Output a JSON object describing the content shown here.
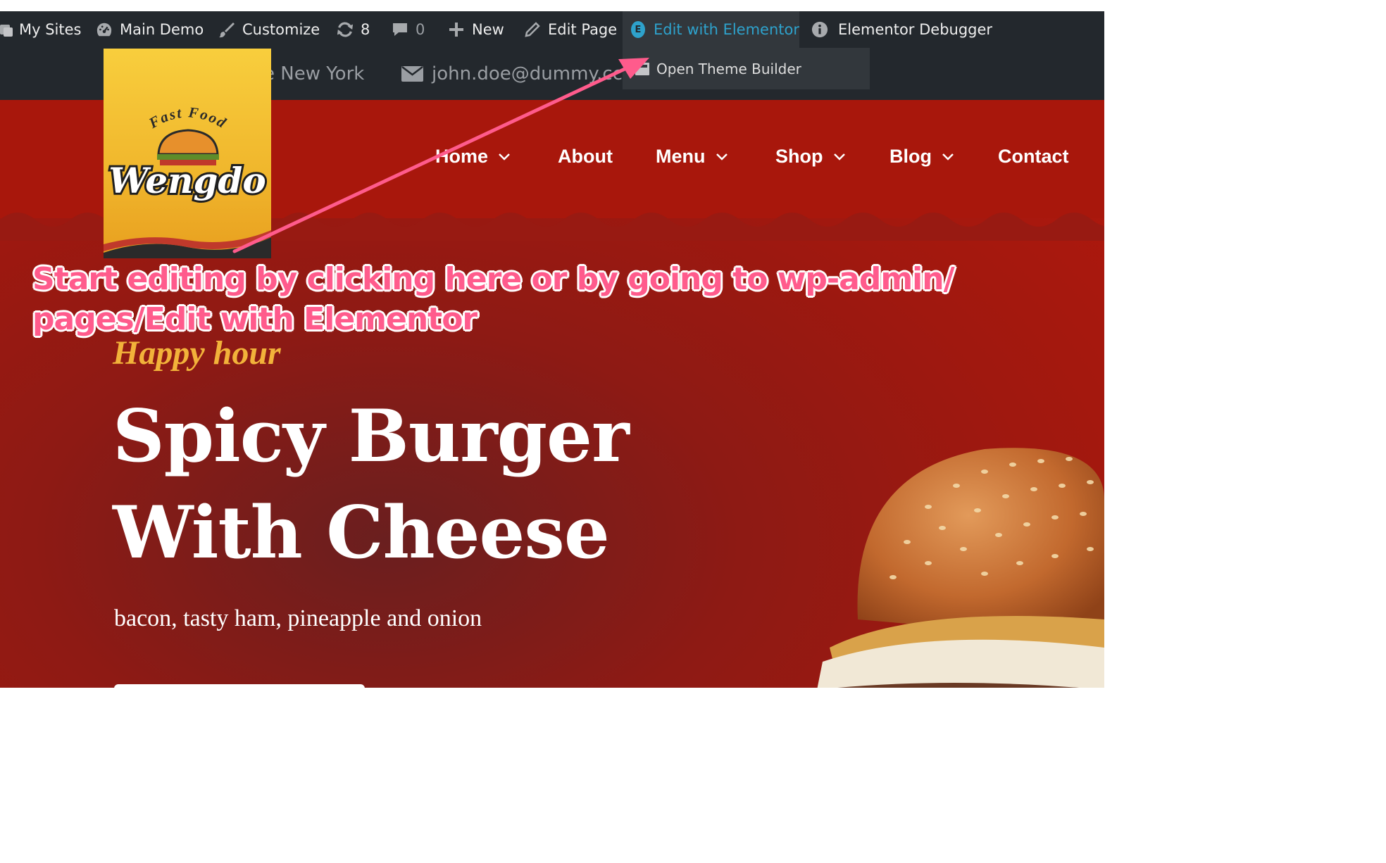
{
  "admin_bar": {
    "my_sites": "My Sites",
    "site_name": "Main Demo",
    "customize": "Customize",
    "updates_count": "8",
    "comments_count": "0",
    "new": "New",
    "edit_page": "Edit Page",
    "edit_with_elementor": "Edit with Elementor",
    "elementor_logo_letter": "E",
    "elementor_debugger": "Elementor Debugger",
    "dropdown_item": "Open Theme Builder"
  },
  "top_info": {
    "location": "e New York",
    "email": "john.doe@dummy.cc"
  },
  "logo": {
    "tagline": "Fast Food",
    "name": "Wengdo"
  },
  "nav": {
    "items": [
      {
        "label": "Home",
        "has_dropdown": true
      },
      {
        "label": "About",
        "has_dropdown": false
      },
      {
        "label": "Menu",
        "has_dropdown": true
      },
      {
        "label": "Shop",
        "has_dropdown": true
      },
      {
        "label": "Blog",
        "has_dropdown": true
      },
      {
        "label": "Contact",
        "has_dropdown": false
      }
    ]
  },
  "hero": {
    "kicker": "Happy hour",
    "title_line1": "Spicy Burger",
    "title_line2": "With Cheese",
    "subtitle": "bacon, tasty ham, pineapple and onion"
  },
  "annotation": {
    "text": "Start editing by clicking here or by going to wp-admin/ pages/Edit with Elementor",
    "color": "#ff5b8c"
  },
  "colors": {
    "admin_bar": "#23282d",
    "admin_active": "#32373c",
    "elementor_blue": "#2ea2cc",
    "hero_red": "#a8170c",
    "logo_yellow": "#f5c233",
    "kicker_gold": "#f2b23a"
  }
}
